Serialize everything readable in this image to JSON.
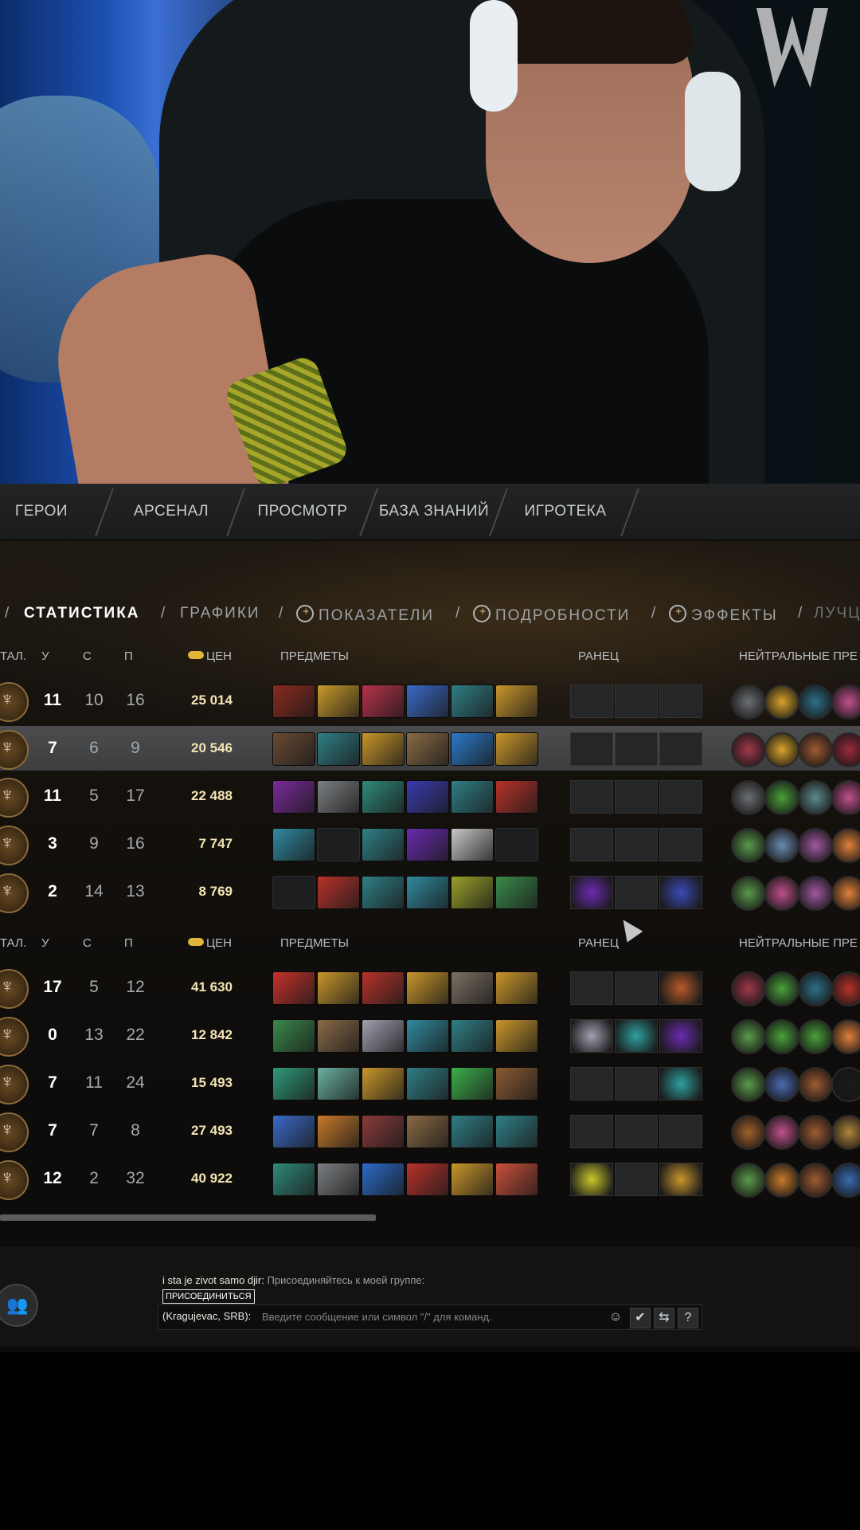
{
  "nav": {
    "tabs": [
      "ГЕРОИ",
      "АРСЕНАЛ",
      "ПРОСМОТР",
      "БАЗА ЗНАНИЙ",
      "ИГРОТЕКА"
    ]
  },
  "subtabs": {
    "items": [
      "СТАТИСТИКА",
      "ГРАФИКИ",
      "ПОКАЗАТЕЛИ",
      "ПОДРОБНОСТИ",
      "ЭФФЕКТЫ",
      "ЛУЧЦ"
    ],
    "active": "СТАТИСТИКА"
  },
  "columns": {
    "tal": "ТАЛ.",
    "k": "У",
    "d": "С",
    "a": "П",
    "worth": "ЦЕН",
    "items": "ПРЕДМЕТЫ",
    "backpack": "РАНЕЦ",
    "neutral": "НЕЙТРАЛЬНЫЕ ПРЕ"
  },
  "team1": [
    {
      "k": "11",
      "d": "10",
      "a": "16",
      "gold": "25 014",
      "highlight": false,
      "items": [
        "#8a2a1e",
        "#c99a2a",
        "#b8324a",
        "#3a6ac8",
        "#2f7f86",
        "#c9962a"
      ],
      "backpack": [
        "",
        "",
        ""
      ],
      "neutrals": [
        "#6c6f72",
        "#d9a42a",
        "#2f6f86",
        "#c0508c"
      ]
    },
    {
      "k": "7",
      "d": "6",
      "a": "9",
      "gold": "20 546",
      "highlight": true,
      "items": [
        "#6a4a32",
        "#2f7f86",
        "#c9962a",
        "#8a6a46",
        "#2a7acb",
        "#c9962a"
      ],
      "backpack": [
        "",
        "",
        ""
      ],
      "neutrals": [
        "#a0384a",
        "#d9a42a",
        "#a05a32",
        "#9a2a3a"
      ]
    },
    {
      "k": "11",
      "d": "5",
      "a": "17",
      "gold": "22 488",
      "highlight": false,
      "items": [
        "#7a2a9a",
        "#7c7f82",
        "#2f8a7a",
        "#3a3ab0",
        "#2f7f86",
        "#b8322a"
      ],
      "backpack": [
        "",
        "",
        ""
      ],
      "neutrals": [
        "#6c6f72",
        "#4aa03a",
        "#5e8a8e",
        "#c0508c"
      ]
    },
    {
      "k": "3",
      "d": "9",
      "a": "16",
      "gold": "7 747",
      "highlight": false,
      "items": [
        "#2f8aa0",
        "",
        "#2f7f86",
        "#6a2ab0",
        "#c8c8c8",
        ""
      ],
      "backpack": [
        "",
        "",
        ""
      ],
      "neutrals": [
        "#5a9a4a",
        "#6a8ab0",
        "#a05aa0",
        "#e0803a"
      ]
    },
    {
      "k": "2",
      "d": "14",
      "a": "13",
      "gold": "8 769",
      "highlight": false,
      "items": [
        "",
        "#b8322a",
        "#2f7f86",
        "#2f8aa0",
        "#9aa02a",
        "#3a8a4a"
      ],
      "backpack": [
        "#6a2ab0",
        "",
        "#3a4ab8"
      ],
      "neutrals": [
        "#5a9a4a",
        "#c0508c",
        "#a05aa0",
        "#e0803a"
      ]
    }
  ],
  "team2": [
    {
      "k": "17",
      "d": "5",
      "a": "12",
      "gold": "41 630",
      "highlight": false,
      "items": [
        "#c8322a",
        "#c9962a",
        "#b8322a",
        "#c9962a",
        "#7c6f62",
        "#c9962a"
      ],
      "backpack": [
        "",
        "",
        "#b85a2a"
      ],
      "neutrals": [
        "#a0384a",
        "#4aa03a",
        "#2f6f86",
        "#b8322a"
      ]
    },
    {
      "k": "0",
      "d": "13",
      "a": "22",
      "gold": "12 842",
      "highlight": false,
      "items": [
        "#3a8a4a",
        "#8a6a46",
        "#a0a0b0",
        "#2f8aa0",
        "#2f7f86",
        "#c9962a"
      ],
      "backpack": [
        "#a0a0b0",
        "#2fa0a0",
        "#6a2ab0"
      ],
      "neutrals": [
        "#5a9a4a",
        "#4aa03a",
        "#4aa03a",
        "#e0803a"
      ]
    },
    {
      "k": "7",
      "d": "11",
      "a": "24",
      "gold": "15 493",
      "highlight": false,
      "items": [
        "#2f9a7a",
        "#6ab0a0",
        "#c9962a",
        "#2f7f86",
        "#3ab04a",
        "#8a5a32"
      ],
      "backpack": [
        "",
        "",
        "#2fa0a0"
      ],
      "neutrals": [
        "#5a9a4a",
        "#4a6ab0",
        "#a05a32",
        "#1a1a1a"
      ]
    },
    {
      "k": "7",
      "d": "7",
      "a": "8",
      "gold": "27 493",
      "highlight": false,
      "items": [
        "#3a6ac8",
        "#c87a2a",
        "#8a3a3a",
        "#8a6a46",
        "#2f7f86",
        "#2f7f86"
      ],
      "backpack": [
        "",
        "",
        ""
      ],
      "neutrals": [
        "#a0602a",
        "#c0508c",
        "#a05a32",
        "#b0843a"
      ]
    },
    {
      "k": "12",
      "d": "2",
      "a": "32",
      "gold": "40 922",
      "highlight": false,
      "items": [
        "#2f8a7a",
        "#7c7f82",
        "#2a6ac8",
        "#b8322a",
        "#c9962a",
        "#c8503a"
      ],
      "backpack": [
        "#c8c82a",
        "",
        "#c9962a"
      ],
      "neutrals": [
        "#5a9a4a",
        "#c87a2a",
        "#a05a32",
        "#3a6ab0"
      ]
    }
  ],
  "chat": {
    "sender": "i sta je zivot samo djir:",
    "invite_text": "Присоединяйтесь к моей группе:",
    "join_label": "ПРИСОЕДИНИТЬСЯ",
    "channel": "(Kragujevac, SRB):",
    "placeholder": "Введите сообщение или символ \"/\" для команд.",
    "help": "?"
  }
}
